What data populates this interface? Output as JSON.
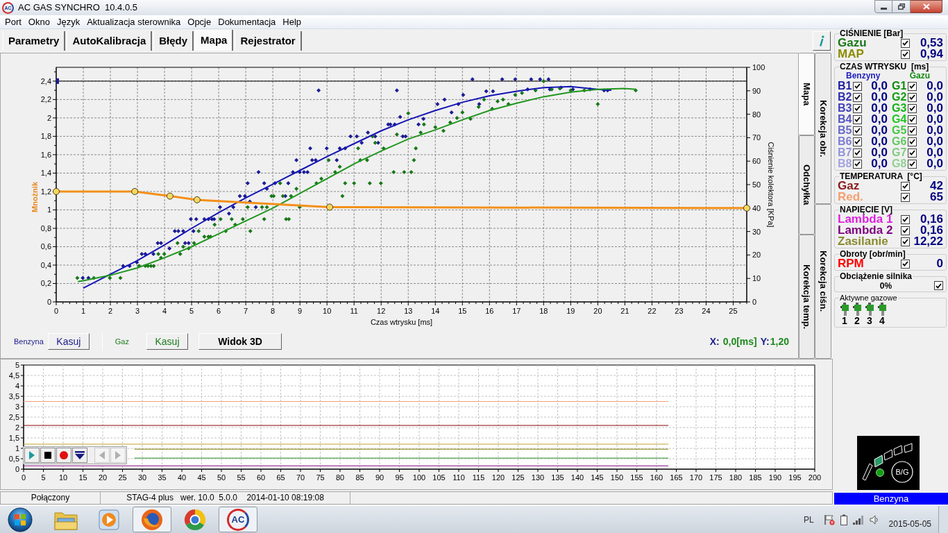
{
  "window": {
    "logo": "AC",
    "title": "AC GAS SYNCHRO  10.4.0.5"
  },
  "menu": [
    "Port",
    "Okno",
    "Język",
    "Aktualizacja sterownika",
    "Opcje",
    "Dokumentacja",
    "Help"
  ],
  "tabs": [
    {
      "label": "Parametry",
      "selected": false
    },
    {
      "label": "AutoKalibracja",
      "selected": false
    },
    {
      "label": "Błędy",
      "selected": false
    },
    {
      "label": "Mapa",
      "selected": true
    },
    {
      "label": "Rejestrator",
      "selected": false
    }
  ],
  "map_panel": {
    "chart": {
      "chart_data": {
        "type": "line",
        "xlabel": "Czas wtrysku [ms]",
        "ylabel": "Mnożnik",
        "grid": true,
        "xlim": [
          0,
          25.5
        ],
        "ylim": [
          0,
          2.55
        ],
        "xticks": [
          0,
          1,
          2,
          3,
          4,
          5,
          6,
          7,
          8,
          9,
          10,
          11,
          12,
          13,
          14,
          15,
          16,
          17,
          18,
          19,
          20,
          21,
          22,
          23,
          24,
          25
        ],
        "yticks": [
          0,
          {
            "value": 0.2,
            "label": "0,2"
          },
          {
            "value": 0.4,
            "label": "0,4"
          },
          {
            "value": 0.6,
            "label": "0,6"
          },
          {
            "value": 0.8,
            "label": "0,8"
          },
          1,
          {
            "value": 1.2,
            "label": "1,2"
          },
          {
            "value": 1.4,
            "label": "1,4"
          },
          {
            "value": 1.6,
            "label": "1,6"
          },
          {
            "value": 1.8,
            "label": "1,8"
          },
          2,
          {
            "value": 2.2,
            "label": "2,2"
          },
          {
            "value": 2.4,
            "label": "2,4"
          }
        ],
        "series": [
          {
            "color": "#000000",
            "x": [
              0,
              25.5
            ],
            "values": [
              2.4,
              2.4
            ]
          },
          {
            "type": "scatter",
            "marker": "square",
            "color": "#1c1c96",
            "x": [
              0
            ],
            "values": [
              2.4
            ]
          },
          {
            "type": "scatter",
            "marker": "diamond",
            "color": "#1c1c96",
            "x": [
              0.98,
              1.19,
              2.47,
              2.71,
              2.98,
              3.16,
              3.29,
              3.59,
              3.75,
              3.87,
              4.18,
              4.38,
              4.51,
              4.69,
              4.76,
              4.89,
              4.97,
              5.07,
              5.17,
              5.47,
              5.62,
              5.75,
              5.83,
              6.05,
              6.38,
              6.54,
              6.78,
              6.97,
              7.07,
              7.15,
              7.37,
              7.47,
              7.68,
              7.78,
              8.08,
              8.46,
              8.57,
              8.74,
              8.87,
              8.99,
              9.15,
              9.28,
              9.38,
              9.45,
              9.58,
              9.69,
              9.99,
              10.36,
              10.47,
              10.67,
              10.87,
              11.1,
              11.28,
              11.51,
              11.78,
              11.89,
              12.26,
              12.34,
              12.5,
              12.58,
              12.7,
              12.8,
              12.9,
              13.38,
              13.56,
              14.08,
              14.34,
              14.6,
              14.85,
              15.03,
              15.37,
              15.62,
              15.88,
              16.13,
              16.47,
              16.95,
              17.41,
              17.54,
              17.87,
              18.18,
              18.23,
              18.64,
              19.08,
              19.72,
              20.23,
              20.36
            ],
            "values": [
              0.26,
              0.26,
              0.39,
              0.39,
              0.43,
              0.52,
              0.52,
              0.52,
              0.64,
              0.64,
              0.58,
              0.77,
              0.77,
              0.77,
              0.64,
              0.64,
              0.9,
              0.77,
              0.9,
              0.9,
              0.9,
              0.9,
              0.9,
              1.03,
              0.96,
              1.03,
              1.15,
              1.15,
              1.29,
              1.09,
              1.03,
              1.41,
              1.29,
              1.23,
              1.29,
              1.15,
              1.29,
              1.41,
              1.54,
              1.41,
              1.41,
              1.41,
              1.67,
              1.54,
              1.54,
              2.3,
              1.67,
              1.54,
              1.67,
              1.67,
              1.8,
              1.8,
              1.73,
              1.84,
              1.8,
              1.73,
              1.93,
              1.93,
              1.93,
              2.3,
              2.01,
              1.8,
              1.8,
              1.93,
              1.99,
              2.15,
              2.2,
              2.06,
              2.15,
              2.25,
              2.42,
              2.15,
              2.29,
              2.29,
              2.42,
              2.42,
              2.31,
              2.42,
              2.42,
              2.42,
              2.31,
              2.33,
              2.31,
              2.31,
              2.3,
              2.3
            ]
          },
          {
            "type": "scatter",
            "marker": "diamond",
            "color": "#187818",
            "x": [
              0.78,
              1.39,
              1.98,
              2.37,
              3.06,
              3.29,
              3.39,
              3.5,
              3.6,
              3.77,
              3.87,
              3.99,
              4.48,
              4.58,
              4.69,
              4.89,
              5.09,
              5.26,
              5.47,
              5.62,
              5.7,
              5.85,
              6.07,
              6.26,
              6.48,
              6.61,
              6.89,
              7.07,
              7.17,
              7.6,
              7.68,
              7.78,
              7.95,
              8.03,
              8.27,
              8.37,
              8.49,
              8.59,
              8.67,
              8.87,
              8.99,
              9.61,
              9.79,
              10.06,
              10.3,
              10.47,
              10.57,
              10.67,
              11,
              11.15,
              11.23,
              11.48,
              11.58,
              11.68,
              11.78,
              11.99,
              12.09,
              12.46,
              12.58,
              12.85,
              13,
              13.11,
              13.21,
              13.28,
              13.46,
              13.58,
              14,
              14.3,
              14.55,
              14.8,
              15,
              15.3,
              15.6,
              15.8,
              16.1,
              16.3,
              16.5,
              16.7,
              16.95,
              17.2,
              17.7,
              18,
              18.3,
              18.6,
              19,
              19.5,
              20,
              21.4
            ],
            "values": [
              0.26,
              0.26,
              0.26,
              0.26,
              0.39,
              0.39,
              0.39,
              0.39,
              0.39,
              0.52,
              0.48,
              0.52,
              0.64,
              0.52,
              0.6,
              0.58,
              0.64,
              0.77,
              0.71,
              0.71,
              0.71,
              0.84,
              0.9,
              0.77,
              0.9,
              0.84,
              0.9,
              1.03,
              0.77,
              1.03,
              0.9,
              1.03,
              1.15,
              1.15,
              1.29,
              1.15,
              0.9,
              0.9,
              1.15,
              1.23,
              1.03,
              1.29,
              1.34,
              1.54,
              1.41,
              1.47,
              1.15,
              1.29,
              1.29,
              1.67,
              1.54,
              1.54,
              1.29,
              1.8,
              1.73,
              1.29,
              1.67,
              1.41,
              1.82,
              1.41,
              2.05,
              1.41,
              1.54,
              1.67,
              1.84,
              1.93,
              1.9,
              1.86,
              1.95,
              2,
              2.06,
              1.99,
              2.12,
              2.2,
              2.1,
              2.18,
              2.2,
              2.15,
              2.25,
              2.27,
              2.3,
              2.4,
              2.31,
              2.32,
              2.3,
              2.3,
              2.15,
              2.3
            ]
          },
          {
            "color": "#1414b4",
            "x": [
              1,
              2,
              3,
              4,
              5,
              6,
              7,
              8,
              9,
              10,
              11,
              12,
              13,
              14,
              15,
              16,
              17,
              18,
              19,
              20,
              20.5
            ],
            "values": [
              0.15,
              0.3,
              0.45,
              0.62,
              0.8,
              0.97,
              1.13,
              1.28,
              1.43,
              1.58,
              1.72,
              1.86,
              1.98,
              2.08,
              2.17,
              2.24,
              2.29,
              2.33,
              2.34,
              2.31,
              2.3
            ]
          },
          {
            "color": "#20961e",
            "x": [
              0.8,
              1,
              2,
              3,
              4,
              5,
              6,
              7,
              8,
              9,
              10,
              11,
              12,
              13,
              14,
              15,
              16,
              17,
              18,
              19,
              20,
              21,
              21.4
            ],
            "values": [
              0.22,
              0.23,
              0.29,
              0.37,
              0.48,
              0.6,
              0.74,
              0.88,
              1.02,
              1.18,
              1.34,
              1.5,
              1.64,
              1.77,
              1.87,
              1.98,
              2.08,
              2.16,
              2.23,
              2.28,
              2.31,
              2.32,
              2.31
            ]
          },
          {
            "marker": "circle",
            "color": "#f39019",
            "x": [
              0,
              2.9,
              4.2,
              5.2,
              10.1,
              25.5
            ],
            "values": [
              1.2,
              1.2,
              1.15,
              1.11,
              1.03,
              1.02
            ]
          }
        ]
      },
      "right_axis_label": "Ciśnienie kolektora [KPa]",
      "right_axis_ticks": [
        "100",
        "90",
        "80",
        "70",
        "60",
        "50",
        "40",
        "30",
        "20",
        "10",
        "0"
      ]
    },
    "side_tabs": {
      "inner_row": [
        {
          "label": "Mapa",
          "selected": true
        },
        {
          "label": "Odchyłka",
          "selected": false
        },
        {
          "label": "Korekcja temp.",
          "selected": false
        }
      ],
      "outer_row": [
        {
          "label": "Korekcja obr.",
          "selected": false
        },
        {
          "label": "Korekcja ciśn.",
          "selected": false
        }
      ]
    },
    "controls": {
      "petrol": {
        "label": "Benzyna",
        "button": "Kasuj"
      },
      "gas": {
        "label": "Gaz",
        "button": "Kasuj"
      },
      "view_3d": "Widok 3D"
    },
    "cursor": {
      "x_label": "X:",
      "x_value": "0,0[ms]",
      "y_label": "Y:",
      "y_value": "1,20"
    }
  },
  "recorder": {
    "chart_data": {
      "type": "line",
      "grid": true,
      "xlim": [
        0,
        200
      ],
      "ylim": [
        0,
        5
      ],
      "xticks": [
        0,
        5,
        10,
        15,
        20,
        25,
        30,
        35,
        40,
        45,
        50,
        55,
        60,
        65,
        70,
        75,
        80,
        85,
        90,
        95,
        100,
        105,
        110,
        115,
        120,
        125,
        130,
        135,
        140,
        145,
        150,
        155,
        160,
        165,
        170,
        175,
        180,
        185,
        190,
        195,
        200
      ],
      "yticks": [
        0,
        {
          "value": 0.5,
          "label": "0,5"
        },
        1,
        {
          "value": 1.5,
          "label": "1,5"
        },
        2,
        {
          "value": 2.5,
          "label": "2,5"
        },
        3,
        {
          "value": 3.5,
          "label": "3,5"
        },
        4,
        {
          "value": 4.5,
          "label": "4,5"
        },
        5
      ],
      "series": [
        {
          "color": "#f4a07a",
          "x": [
            0,
            163
          ],
          "values": [
            3.25,
            3.25
          ]
        },
        {
          "color": "#8b0000",
          "x": [
            0,
            163
          ],
          "values": [
            2.1,
            2.1
          ]
        },
        {
          "color": "#c0a030",
          "x": [
            0,
            163
          ],
          "values": [
            1.2,
            1.2
          ]
        },
        {
          "color": "#7a7a00",
          "x": [
            28,
            163
          ],
          "values": [
            0.96,
            0.96
          ]
        },
        {
          "color": "#208c20",
          "x": [
            28,
            163
          ],
          "values": [
            0.53,
            0.53
          ]
        },
        {
          "color": "#800080",
          "x": [
            0,
            163
          ],
          "values": [
            0.16,
            0.16
          ]
        }
      ]
    },
    "toolbar": [
      {
        "kind": "play",
        "disabled": false
      },
      {
        "kind": "stop",
        "disabled": false
      },
      {
        "kind": "record",
        "disabled": false
      },
      {
        "kind": "marker",
        "disabled": false
      },
      {
        "kind": "previous",
        "disabled": true
      },
      {
        "kind": "next",
        "disabled": true
      }
    ]
  },
  "status_bar": {
    "connection": "Połączony",
    "device": "STAG-4 plus   wer. 10.0  5.0.0    2014-01-10 08:19:08"
  },
  "right_panel": {
    "pressure": {
      "title": "CIŚNIENIE [Bar]",
      "rows": [
        {
          "label": "Gazu",
          "color": "#187818",
          "checked": true,
          "value": "0,53"
        },
        {
          "label": "MAP",
          "color": "#8c8c00",
          "checked": true,
          "value": "0,94"
        }
      ]
    },
    "injection": {
      "title": "CZAS WTRYSKU  [ms]",
      "petrol_header": "Benzyny",
      "gas_header": "Gazu",
      "rows": [
        {
          "petrol": {
            "label": "B1",
            "color": "#1e1ea0",
            "checked": true,
            "value": "0,0"
          },
          "gas": {
            "label": "G1",
            "color": "#108c10",
            "checked": true,
            "value": "0,0"
          }
        },
        {
          "petrol": {
            "label": "B2",
            "color": "#3030b0",
            "checked": true,
            "value": "0,0"
          },
          "gas": {
            "label": "G2",
            "color": "#10a010",
            "checked": true,
            "value": "0,0"
          }
        },
        {
          "petrol": {
            "label": "B3",
            "color": "#4242bc",
            "checked": true,
            "value": "0,0"
          },
          "gas": {
            "label": "G3",
            "color": "#14b414",
            "checked": true,
            "value": "0,0"
          }
        },
        {
          "petrol": {
            "label": "B4",
            "color": "#5656c4",
            "checked": true,
            "value": "0,0"
          },
          "gas": {
            "label": "G4",
            "color": "#20c820",
            "checked": true,
            "value": "0,0"
          }
        },
        {
          "petrol": {
            "label": "B5",
            "color": "#6a6acc",
            "checked": true,
            "value": "0,0"
          },
          "gas": {
            "label": "G5",
            "color": "#44c844",
            "checked": true,
            "value": "0,0"
          }
        },
        {
          "petrol": {
            "label": "B6",
            "color": "#7e7ed4",
            "checked": true,
            "value": "0,0"
          },
          "gas": {
            "label": "G6",
            "color": "#64c864",
            "checked": true,
            "value": "0,0"
          }
        },
        {
          "petrol": {
            "label": "B7",
            "color": "#9494dc",
            "checked": true,
            "value": "0,0"
          },
          "gas": {
            "label": "G7",
            "color": "#80cc80",
            "checked": true,
            "value": "0,0"
          }
        },
        {
          "petrol": {
            "label": "B8",
            "color": "#a4a4e0",
            "checked": true,
            "value": "0,0"
          },
          "gas": {
            "label": "G8",
            "color": "#92d092",
            "checked": true,
            "value": "0,0"
          }
        }
      ]
    },
    "temperature": {
      "title": "TEMPERATURA  [°C]",
      "rows": [
        {
          "label": "Gaz",
          "color": "#8b1a1a",
          "checked": true,
          "value": "42"
        },
        {
          "label": "Red.",
          "color": "#f4a070",
          "checked": true,
          "value": "65"
        }
      ]
    },
    "voltage": {
      "title": "NAPIĘCIE [V]",
      "rows": [
        {
          "label": "Lambda 1",
          "color": "#e020e0",
          "checked": true,
          "value": "0,16"
        },
        {
          "label": "Lambda 2",
          "color": "#800080",
          "checked": true,
          "value": "0,16"
        },
        {
          "label": "Zasilanie",
          "color": "#8a8a30",
          "checked": true,
          "value": "12,22"
        }
      ]
    },
    "rpm": {
      "title": "Obroty [obr/min]",
      "rows": [
        {
          "label": "RPM",
          "color": "#ff0000",
          "checked": true,
          "value": "0"
        }
      ]
    },
    "load": {
      "title": "Obciążenie silnika",
      "value": "0%",
      "checked": true
    },
    "injectors": {
      "title": "Aktywne gazowe",
      "items": [
        {
          "label": "1",
          "active": true
        },
        {
          "label": "2",
          "active": true
        },
        {
          "label": "3",
          "active": true
        },
        {
          "label": "4",
          "active": true
        }
      ]
    },
    "fuel_switch": {
      "segments": [
        {
          "on": false
        },
        {
          "on": true
        },
        {
          "on": false
        },
        {
          "on": false
        },
        {
          "on": false
        }
      ],
      "led_on": true,
      "button": "B/G",
      "mode": "Benzyna"
    }
  },
  "taskbar": {
    "apps": [
      {
        "kind": "start",
        "running": false
      },
      {
        "kind": "folder",
        "running": false
      },
      {
        "kind": "media",
        "running": false
      },
      {
        "kind": "globe",
        "running": true
      },
      {
        "kind": "ring",
        "running": false
      },
      {
        "kind": "app",
        "running": true,
        "logo": "AC"
      }
    ],
    "language": "PL",
    "date": "2015-05-05"
  }
}
